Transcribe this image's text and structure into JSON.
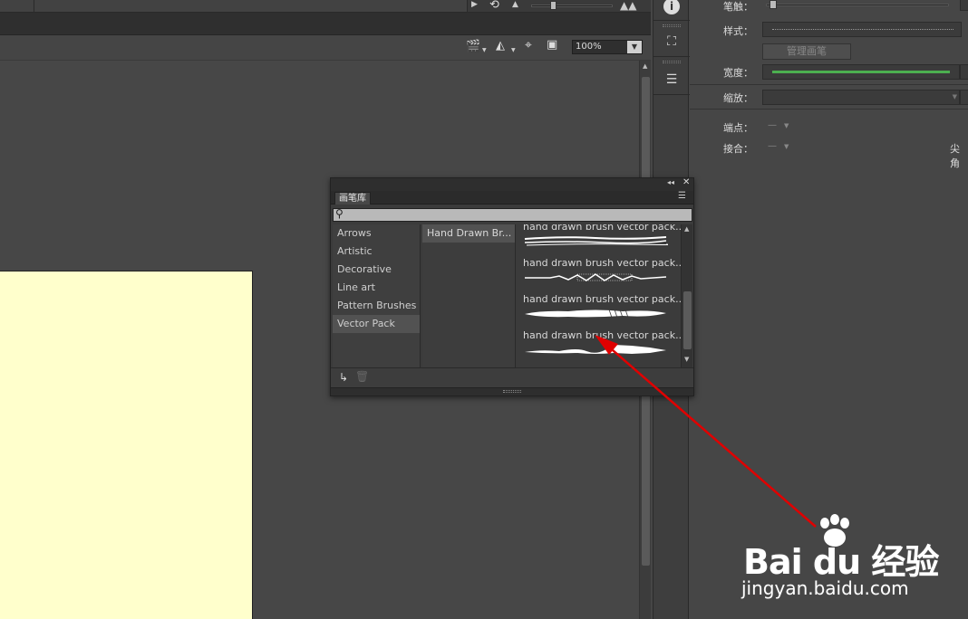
{
  "doc_toolbar": {
    "zoom_value": "100%"
  },
  "stroke_panel": {
    "brush_label": "笔触：",
    "style_label": "样式：",
    "manage_brush_label": "管理画笔",
    "width_label": "宽度：",
    "scale_label": "缩放：",
    "cap_label": "端点：",
    "join_label": "接合：",
    "miter_label": "尖角"
  },
  "brush_library": {
    "tab_label": "画笔库",
    "categories": [
      {
        "label": "Arrows"
      },
      {
        "label": "Artistic"
      },
      {
        "label": "Decorative"
      },
      {
        "label": "Line art"
      },
      {
        "label": "Pattern Brushes"
      },
      {
        "label": "Vector Pack"
      }
    ],
    "selected_category": "Vector Pack",
    "subcategories": [
      {
        "label": "Hand Drawn Br..."
      }
    ],
    "brushes": [
      {
        "name": "hand drawn brush vector pack..."
      },
      {
        "name": "hand drawn brush vector pack..."
      },
      {
        "name": "hand drawn brush vector pack..."
      },
      {
        "name": "hand drawn brush vector pack..."
      }
    ]
  },
  "watermark": {
    "main": "Bai du 经验",
    "sub": "jingyan.baidu.com"
  },
  "colors": {
    "artboard": "#ffffcc",
    "arrow": "#e00000",
    "width_line": "#4caf50"
  }
}
